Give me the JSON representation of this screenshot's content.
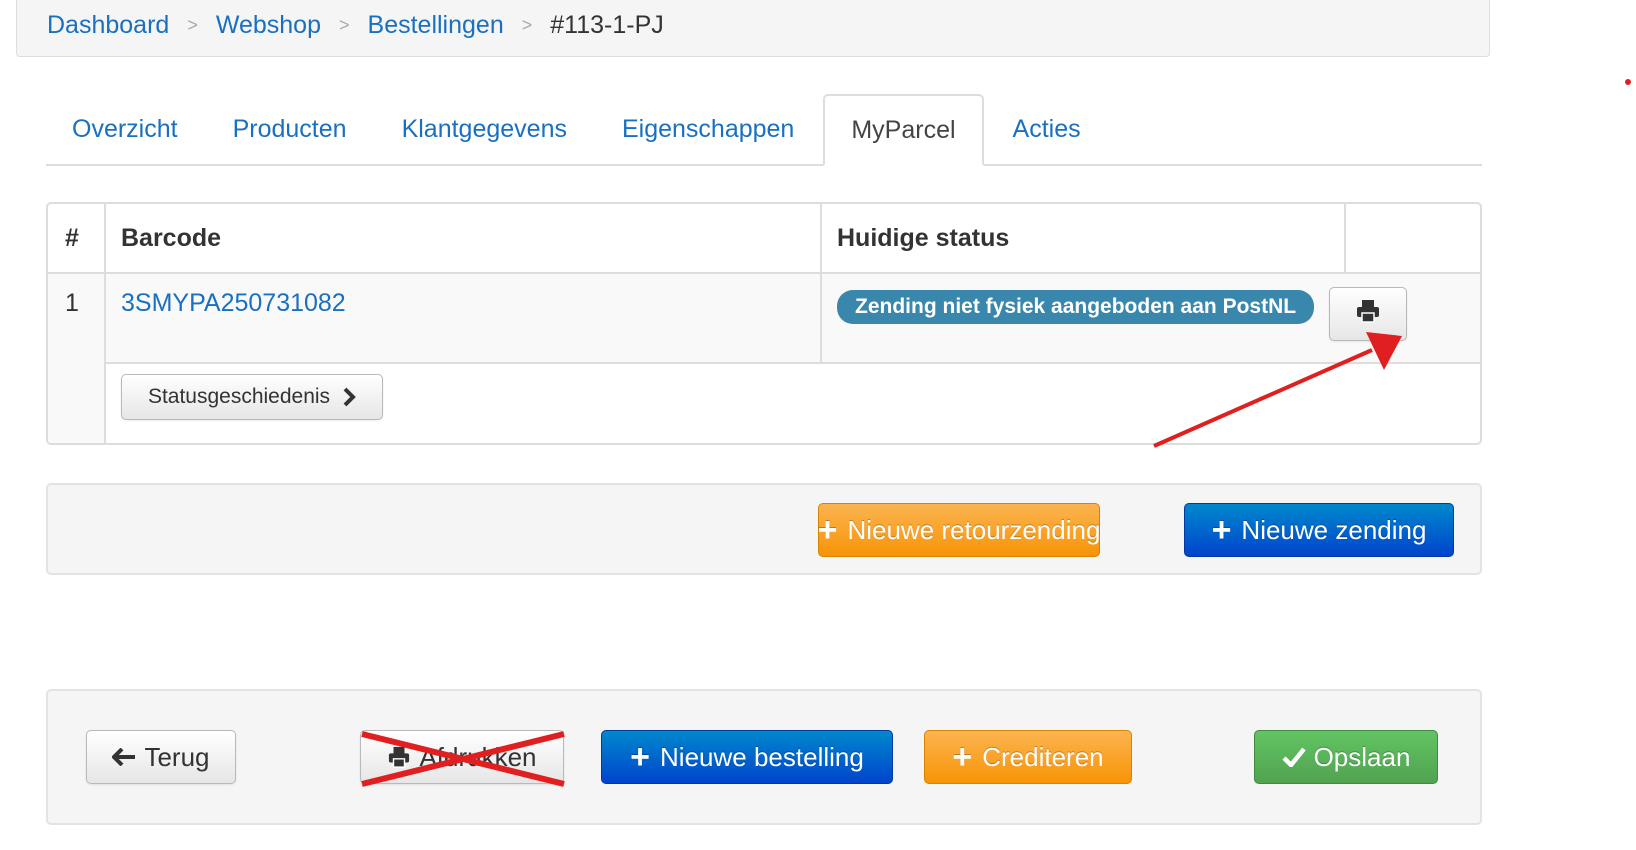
{
  "breadcrumb": {
    "items": [
      "Dashboard",
      "Webshop",
      "Bestellingen"
    ],
    "separator": ">",
    "current": "#113-1-PJ"
  },
  "tabs": [
    {
      "label": "Overzicht",
      "active": false
    },
    {
      "label": "Producten",
      "active": false
    },
    {
      "label": "Klantgegevens",
      "active": false
    },
    {
      "label": "Eigenschappen",
      "active": false
    },
    {
      "label": "MyParcel",
      "active": true
    },
    {
      "label": "Acties",
      "active": false
    }
  ],
  "parcel_table": {
    "headers": {
      "num": "#",
      "barcode": "Barcode",
      "status": "Huidige status"
    },
    "rows": [
      {
        "num": "1",
        "barcode": "3SMYPA250731082",
        "status": "Zending niet fysiek aangeboden aan PostNL",
        "status_color": "#3a87ad",
        "print_icon": "printer-icon",
        "history_button": "Statusgeschiedenis",
        "history_icon": "chevron-right-icon"
      }
    ]
  },
  "shipment_actions": {
    "new_return": "Nieuwe retourzending",
    "new_shipment": "Nieuwe zending"
  },
  "footer_actions": {
    "back": "Terug",
    "print": "Afdrukken",
    "new_order": "Nieuwe bestelling",
    "credit": "Crediteren",
    "save": "Opslaan"
  },
  "colors": {
    "link": "#1a70c0",
    "orange": "#f89406",
    "blue": "#0044cc",
    "green": "#51a351",
    "annotation_red": "#e02020"
  }
}
